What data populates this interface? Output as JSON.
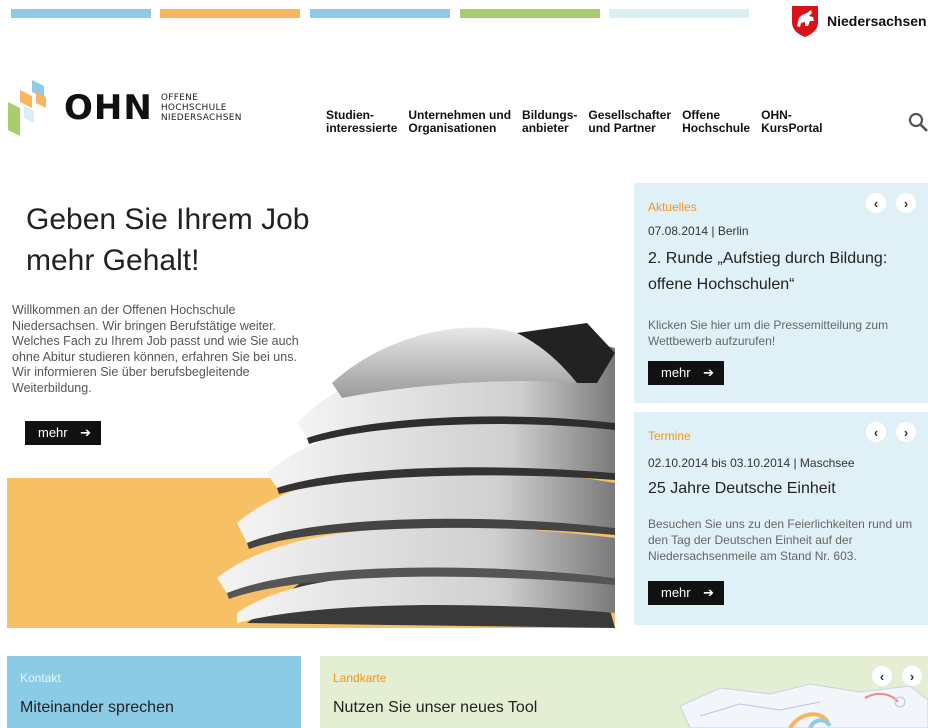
{
  "header": {
    "state_name": "Niedersachsen",
    "logo": {
      "abbr": "OHN",
      "line1": "OFFENE",
      "line2": "HOCHSCHULE",
      "line3": "NIEDERSACHSEN"
    },
    "nav": [
      "Studien-\ninteressierte",
      "Unternehmen und\nOrganisationen",
      "Bildungs-\nanbieter",
      "Gesellschafter\nund Partner",
      "Offene\nHochschule",
      "OHN-\nKursPortal"
    ],
    "colors": {
      "blue": "#8fcbe6",
      "orange": "#f6b55e",
      "green": "#a9cc6d",
      "lightblue": "#dbeef6"
    }
  },
  "hero": {
    "title": "Geben Sie Ihrem Job mehr Gehalt!",
    "text": "Willkommen an der Offenen Hochschule Niedersachsen. Wir bringen Berufstätige weiter. Welches Fach zu Ihrem Job passt und wie Sie auch ohne Abitur studieren können, erfahren Sie bei uns. Wir informieren Sie über berufsbegleitende Weiterbildung.",
    "button": "mehr"
  },
  "aktuelles": {
    "label": "Aktuelles",
    "date": "07.08.2014 | Berlin",
    "title": "2. Runde „Aufstieg durch Bildung: offene Hochschulen“",
    "text": "Klicken Sie hier um die Pressemitteilung zum Wettbewerb aufzurufen!",
    "button": "mehr"
  },
  "termine": {
    "label": "Termine",
    "date": "02.10.2014 bis 03.10.2014 | Maschsee",
    "title": "25 Jahre Deutsche Einheit",
    "text": "Besuchen Sie uns zu den Feierlichkeiten rund um den Tag der Deutschen Einheit auf der Niedersachsenmeile am Stand Nr. 603.",
    "button": "mehr"
  },
  "kontakt": {
    "label": "Kontakt",
    "title": "Miteinander sprechen"
  },
  "landkarte": {
    "label": "Landkarte",
    "title": "Nutzen Sie unser neues Tool"
  },
  "icons": {
    "prev": "chevron-left-icon",
    "next": "chevron-right-icon",
    "search": "search-icon",
    "arrow": "arrow-right-icon"
  }
}
